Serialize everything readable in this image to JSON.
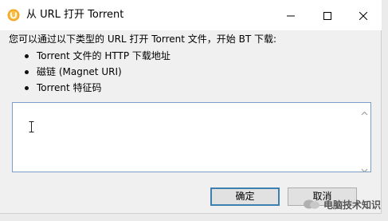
{
  "window": {
    "title": "从 URL 打开 Torrent",
    "icon": "utorrent-logo-icon",
    "controls": [
      "minimize-icon",
      "maximize-icon",
      "close-icon"
    ]
  },
  "prompt": "您可以通过以下类型的 URL 打开 Torrent 文件，开始 BT 下载:",
  "bullets": [
    "Torrent 文件的 HTTP 下载地址",
    "磁链 (Magnet URI)",
    "Torrent 特征码"
  ],
  "url_input": {
    "value": ""
  },
  "buttons": {
    "ok": "确定",
    "cancel": "取消"
  },
  "watermark": {
    "text": "电脑技术知识"
  },
  "colors": {
    "accent": "#3c7fb1",
    "input_border": "#7a9ec7",
    "icon_orange": "#f5a623"
  }
}
